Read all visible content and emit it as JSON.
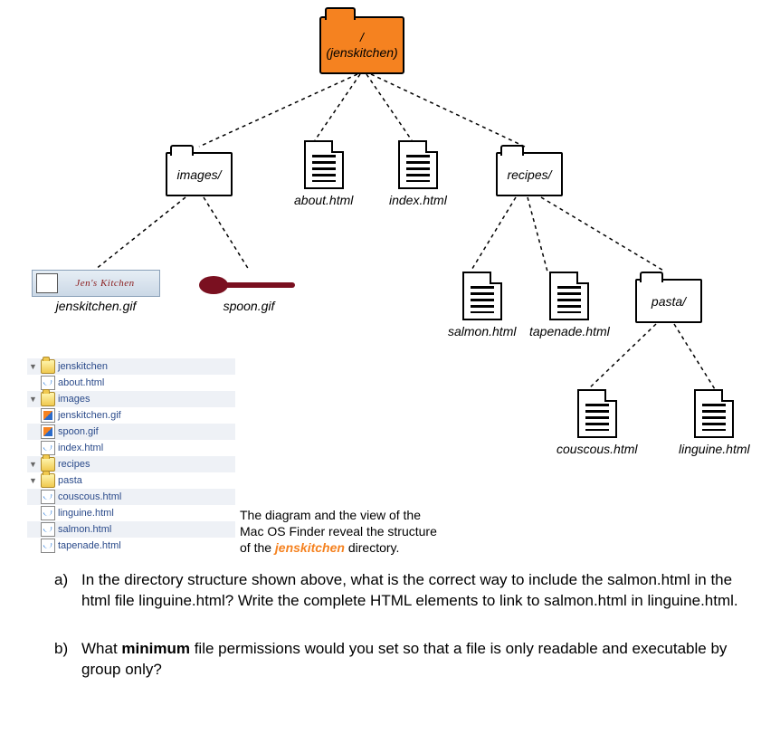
{
  "tree": {
    "root": {
      "top": "/",
      "name": "(jenskitchen)"
    },
    "level1": {
      "images": "images/",
      "about": "about.html",
      "index": "index.html",
      "recipes": "recipes/"
    },
    "level2": {
      "jenskitchen_gif": "jenskitchen.gif",
      "jenskitchen_thumb_text": "Jen's Kitchen",
      "spoon_gif": "spoon.gif",
      "salmon": "salmon.html",
      "tapenade": "tapenade.html",
      "pasta": "pasta/"
    },
    "level3": {
      "couscous": "couscous.html",
      "linguine": "linguine.html"
    }
  },
  "finder": {
    "jenskitchen": "jenskitchen",
    "about": "about.html",
    "images": "images",
    "jk_gif": "jenskitchen.gif",
    "spoon_gif": "spoon.gif",
    "index": "index.html",
    "recipes": "recipes",
    "pasta": "pasta",
    "couscous": "couscous.html",
    "linguine": "linguine.html",
    "salmon": "salmon.html",
    "tapenade": "tapenade.html"
  },
  "caption": {
    "line1": "The diagram and the view of the",
    "line2": "Mac OS Finder reveal the structure",
    "line3_pre": "of the ",
    "highlight": "jenskitchen",
    "line3_post": " directory."
  },
  "questions": {
    "a_letter": "a)",
    "a_text": "In the directory structure shown above, what is the correct way to include the salmon.html in the html file linguine.html?  Write the complete HTML elements to link to salmon.html in linguine.html.",
    "b_letter": "b)",
    "b_text_pre": "What ",
    "b_bold": "minimum",
    "b_text_post": " file permissions would you set so that a file is only readable and executable by group only?"
  }
}
